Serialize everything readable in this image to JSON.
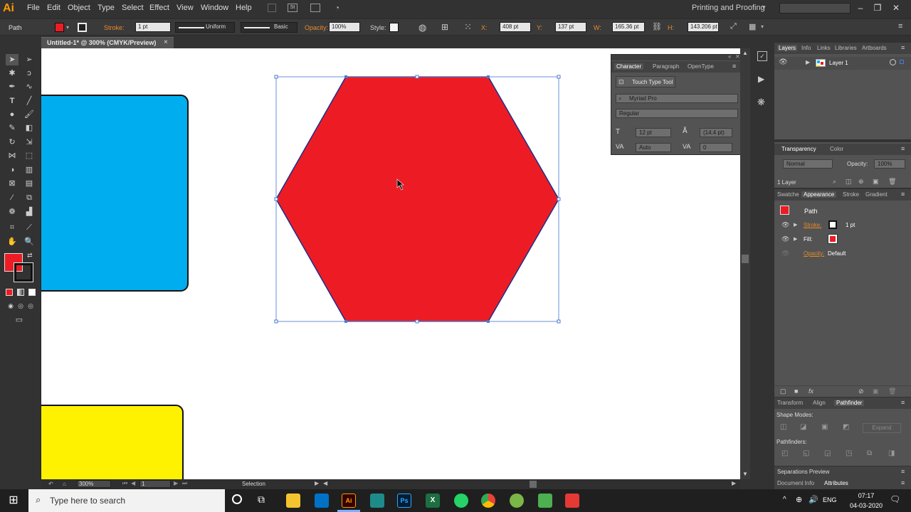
{
  "app": {
    "logo": "Ai",
    "workspace": "Printing and Proofing"
  },
  "menu": [
    "File",
    "Edit",
    "Object",
    "Type",
    "Select",
    "Effect",
    "View",
    "Window",
    "Help"
  ],
  "control_bar": {
    "selection_type": "Path",
    "stroke_label": "Stroke:",
    "stroke_weight": "1 pt",
    "profile": "Uniform",
    "brush": "Basic",
    "opacity_label": "Opacity:",
    "opacity": "100%",
    "style_label": "Style:",
    "x_label": "X:",
    "x": "408 pt",
    "y_label": "Y:",
    "y": "137 pt",
    "w_label": "W:",
    "w": "165.36 pt",
    "h_label": "H:",
    "h": "143.206 pt"
  },
  "document": {
    "tab_title": "Untitled-1* @ 300% (CMYK/Preview)",
    "close": "×"
  },
  "status_bar": {
    "zoom": "300%",
    "artboard": "1",
    "tool": "Selection"
  },
  "character_panel": {
    "tabs": [
      "Character",
      "Paragraph",
      "OpenType"
    ],
    "touch_type": "Touch Type Tool",
    "font": "Myriad Pro",
    "style": "Regular",
    "size": "12 pt",
    "leading": "(14.4 pt)",
    "kerning": "Auto",
    "tracking": "0"
  },
  "layers_panel": {
    "tabs": [
      "Layers",
      "Info",
      "Links",
      "Libraries",
      "Artboards"
    ],
    "layer": "Layer 1",
    "count": "1 Layer"
  },
  "transparency_panel": {
    "tabs": [
      "Transparency",
      "Color"
    ],
    "mode": "Normal",
    "opacity_label": "Opacity:",
    "opacity": "100%"
  },
  "appearance_panel": {
    "tabs": [
      "Swatche",
      "Appearance",
      "Stroke",
      "Gradient"
    ],
    "title": "Path",
    "stroke_label": "Stroke:",
    "stroke_value": "1 pt",
    "fill_label": "Fill:",
    "opacity_label": "Opacity:",
    "opacity_value": "Default"
  },
  "pathfinder_panel": {
    "tabs": [
      "Transform",
      "Align",
      "Pathfinder"
    ],
    "shape_modes": "Shape Modes:",
    "pathfinders": "Pathfinders:",
    "expand": "Expand"
  },
  "bottom_panels": {
    "separations": "Separations Preview",
    "doc_info": "Document Info",
    "attributes": "Attributes"
  },
  "taskbar": {
    "search_placeholder": "Type here to search",
    "lang": "ENG",
    "time": "07:17",
    "date": "04-03-2020"
  },
  "colors": {
    "fill_red": "#ed1c24",
    "cyan": "#00aeef",
    "yellow": "#fff200",
    "selection_blue": "#4a7bd0",
    "accent_orange": "#e8892d"
  }
}
